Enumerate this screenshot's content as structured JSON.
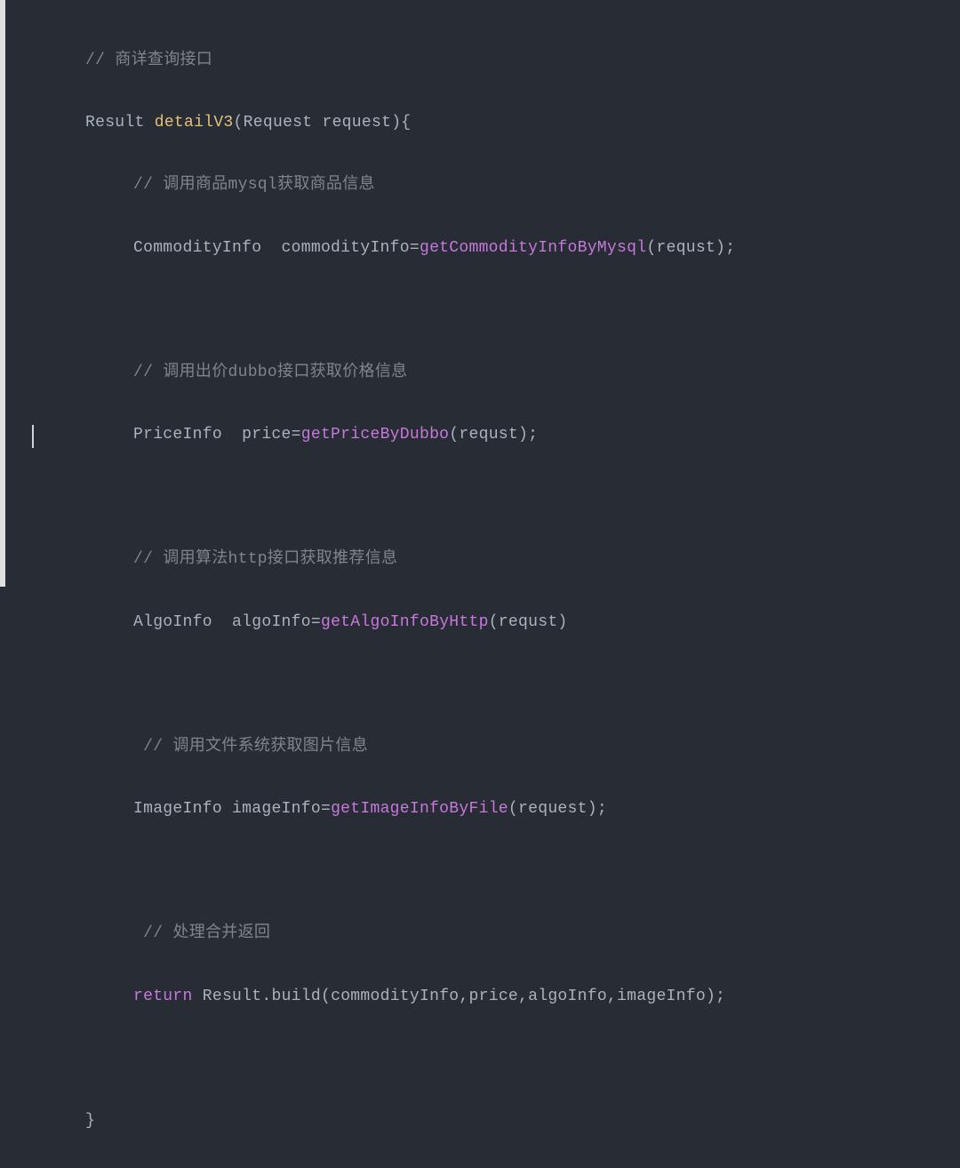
{
  "code": {
    "c1": "// 商详查询接口",
    "sig_type": "Result ",
    "sig_name": "detailV3",
    "sig_params_open": "(",
    "sig_params": "Request request",
    "sig_params_close": "){",
    "c2": "// 调用商品mysql获取商品信息",
    "l2_type": "CommodityInfo  ",
    "l2_var": "commodityInfo",
    "l2_eq": "=",
    "l2_call": "getCommodityInfoByMysql",
    "l2_args": "(requst);",
    "c3": "// 调用出价dubbo接口获取价格信息",
    "l3_type": "PriceInfo  ",
    "l3_var": "price",
    "l3_eq": "=",
    "l3_call": "getPriceByDubbo",
    "l3_args": "(requst);",
    "c4": "// 调用算法http接口获取推荐信息",
    "l4_type": "AlgoInfo  ",
    "l4_var": "algoInfo",
    "l4_eq": "=",
    "l4_call": "getAlgoInfoByHttp",
    "l4_args": "(requst)",
    "c5": " // 调用文件系统获取图片信息",
    "l5_type": "ImageInfo ",
    "l5_var": "imageInfo",
    "l5_eq": "=",
    "l5_call": "getImageInfoByFile",
    "l5_args": "(request);",
    "c6": " // 处理合并返回",
    "ret_kw": "return",
    "ret_sp": " ",
    "ret_obj": "Result",
    "ret_dot": ".",
    "ret_build": "build",
    "ret_args": "(commodityInfo,price,algoInfo,imageInfo);",
    "close": "}"
  }
}
